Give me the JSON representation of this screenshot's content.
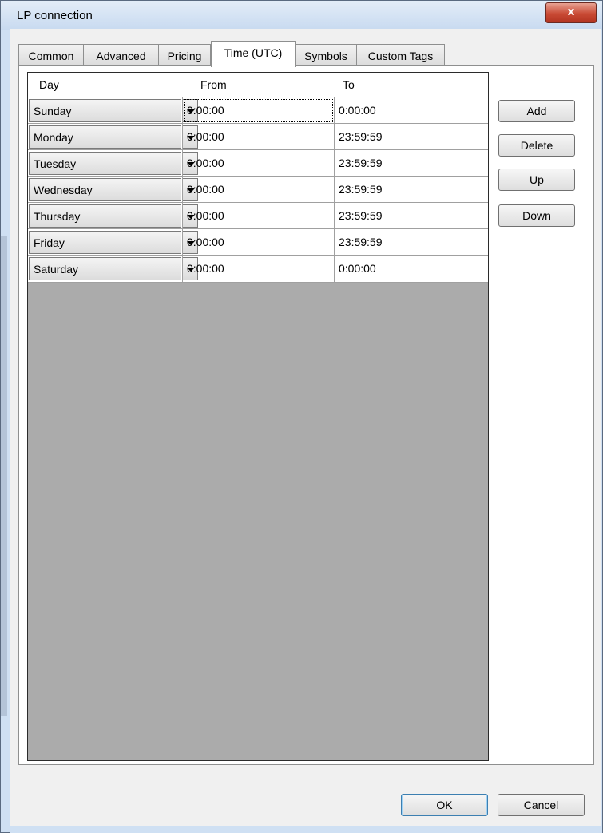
{
  "window": {
    "title": "LP connection",
    "close_glyph": "x"
  },
  "tabs": [
    {
      "label": "Common",
      "active": false
    },
    {
      "label": "Advanced",
      "active": false
    },
    {
      "label": "Pricing",
      "active": false
    },
    {
      "label": "Time (UTC)",
      "active": true
    },
    {
      "label": "Symbols",
      "active": false
    },
    {
      "label": "Custom Tags",
      "active": false
    }
  ],
  "table": {
    "columns": [
      "Day",
      "From",
      "To"
    ],
    "rows": [
      {
        "day": "Sunday",
        "from": "0:00:00",
        "to": "0:00:00",
        "focused": true
      },
      {
        "day": "Monday",
        "from": "0:00:00",
        "to": "23:59:59"
      },
      {
        "day": "Tuesday",
        "from": "0:00:00",
        "to": "23:59:59"
      },
      {
        "day": "Wednesday",
        "from": "0:00:00",
        "to": "23:59:59"
      },
      {
        "day": "Thursday",
        "from": "0:00:00",
        "to": "23:59:59"
      },
      {
        "day": "Friday",
        "from": "0:00:00",
        "to": "23:59:59"
      },
      {
        "day": "Saturday",
        "from": "0:00:00",
        "to": "0:00:00"
      }
    ]
  },
  "side_buttons": {
    "add": "Add",
    "delete": "Delete",
    "up": "Up",
    "down": "Down"
  },
  "footer": {
    "ok": "OK",
    "cancel": "Cancel"
  },
  "icons": {
    "dropdown": "chevron-down-icon",
    "close": "close-icon"
  },
  "colors": {
    "grid_background": "#ababab",
    "close_button": "#c94a35",
    "default_button_border": "#3c7fb1"
  }
}
